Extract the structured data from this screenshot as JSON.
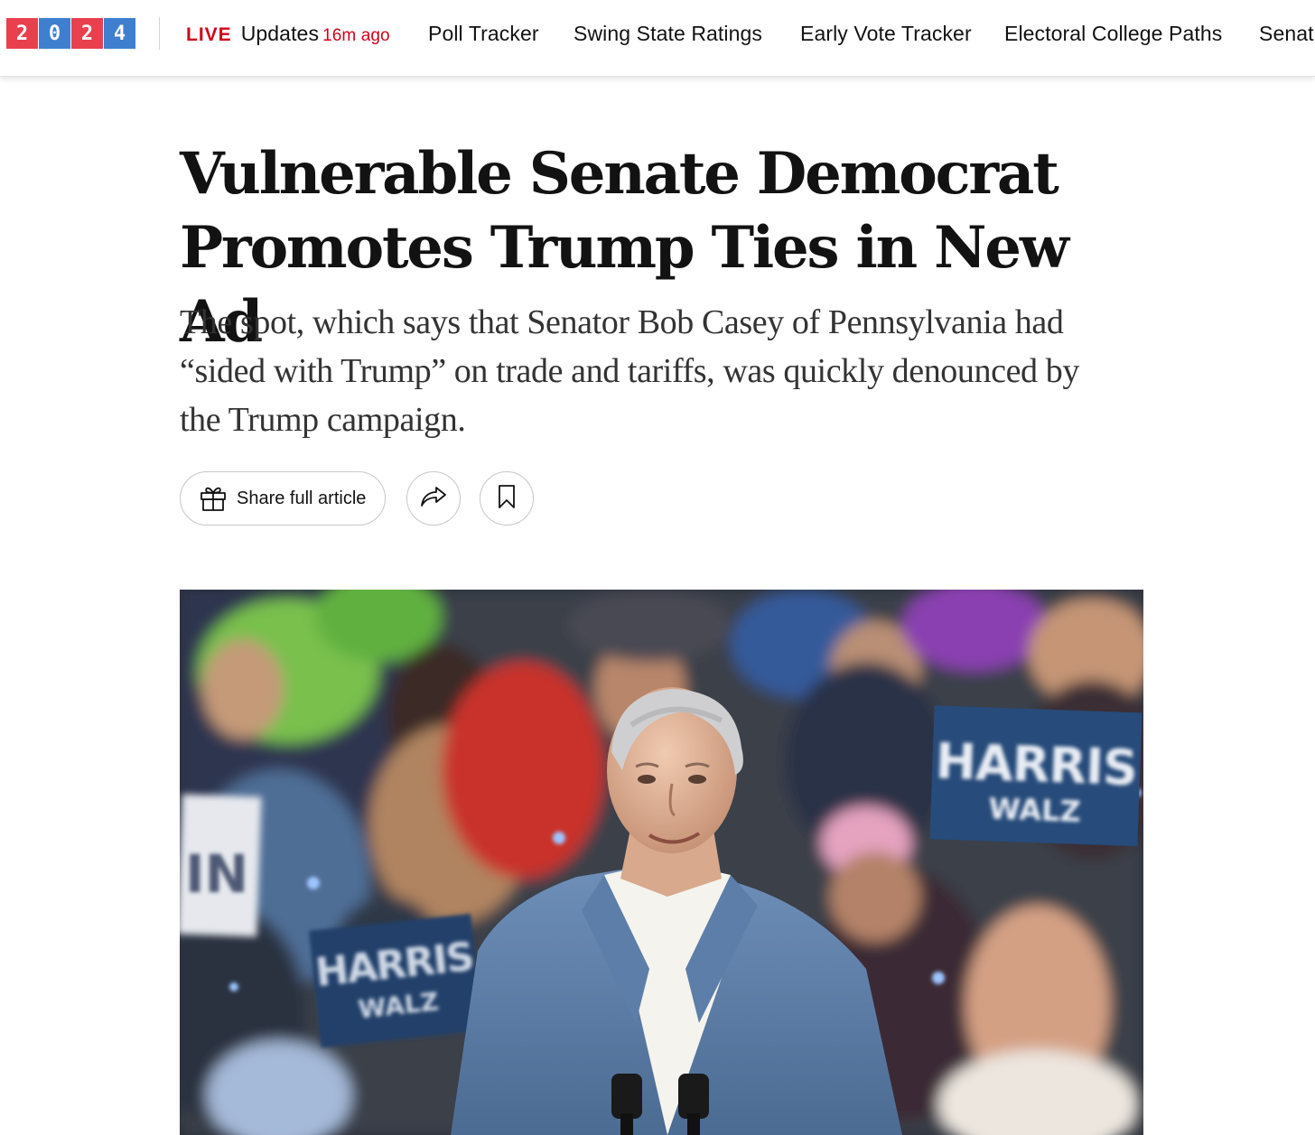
{
  "nav": {
    "year_digits": [
      "2",
      "0",
      "2",
      "4"
    ],
    "live_label": "LIVE",
    "updates_label": "Updates",
    "updates_time": "16m ago",
    "items": [
      {
        "label": "Poll Tracker"
      },
      {
        "label": "Swing State Ratings"
      },
      {
        "label": "Early Vote Tracker"
      },
      {
        "label": "Electoral College Paths"
      },
      {
        "label": "Senat"
      }
    ]
  },
  "article": {
    "headline_line1": "Vulnerable Senate Democrat",
    "headline_line2": "Promotes Trump Ties in New Ad",
    "summary": "The spot, which says that Senator Bob Casey of Pennsylvania had “sided with Trump” on trade and tariffs, was quickly denounced by the Trump campaign."
  },
  "share_bar": {
    "share_full_label": "Share full article",
    "share_icon": "share-arrow-icon",
    "save_icon": "bookmark-icon",
    "gift_icon": "gift-icon"
  },
  "photo": {
    "sign_texts": [
      "HARRIS",
      "WALZ",
      "HARRIS",
      "WALZ",
      "IN"
    ]
  },
  "colors": {
    "live_red": "#d0021b",
    "badge_red": "#e8404d",
    "badge_blue": "#3f7fd0",
    "text": "#121212"
  }
}
